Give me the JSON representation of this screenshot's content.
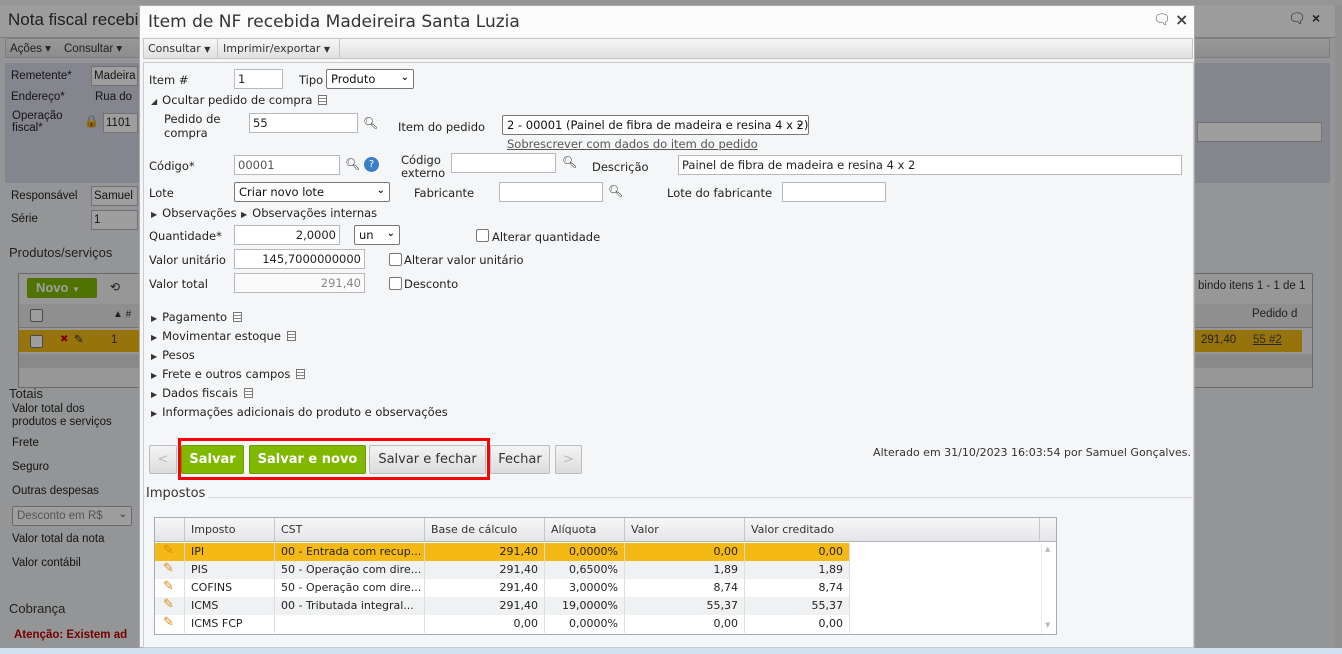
{
  "background": {
    "title": "Nota fiscal recebi",
    "menu": [
      "Ações",
      "Consultar"
    ],
    "remetente_label": "Remetente*",
    "remetente_value": "Madeira",
    "endereco_label": "Endereço*",
    "endereco_value": "Rua do",
    "operacao_label_1": "Operação",
    "operacao_label_2": "fiscal*",
    "operacao_value": "1101",
    "responsavel_label": "Responsável",
    "responsavel_value": "Samuel",
    "serie_label": "Série",
    "serie_value": "1",
    "produtos_title": "Produtos/serviços",
    "novo_label": "Novo",
    "grid_col_num": "#",
    "grid_row_num": "1",
    "paging": "bindo itens 1 - 1 de 1",
    "grid_col_pedido": "Pedido d",
    "grid_row_value": "291,40",
    "grid_row_pedido": "55 #2",
    "totais_title": "Totais",
    "totais": [
      "Valor total dos",
      "produtos e serviços",
      "Frete",
      "Seguro",
      "Outras despesas",
      "Valor total da nota",
      "Valor contábil"
    ],
    "desconto_select": "Desconto em R$",
    "cobranca_title": "Cobrança",
    "warning": "Atenção: Existem ad"
  },
  "modal": {
    "title": "Item de NF recebida Madeireira Santa Luzia",
    "toolbar": [
      "Consultar",
      "Imprimir/exportar"
    ],
    "item_label": "Item #",
    "item_value": "1",
    "tipo_label": "Tipo",
    "tipo_value": "Produto",
    "ocultar_pedido": "Ocultar pedido de compra",
    "pedido_label_1": "Pedido de",
    "pedido_label_2": "compra",
    "pedido_value": "55",
    "item_pedido_label": "Item do pedido",
    "item_pedido_value": "2 - 00001 (Painel de fibra de madeira e resina 4 x 2)",
    "sobrescrever_link": "Sobrescrever com dados do item do pedido",
    "codigo_label": "Código*",
    "codigo_value": "00001",
    "codigo_ext_label_1": "Código",
    "codigo_ext_label_2": "externo",
    "codigo_ext_value": "",
    "descricao_label": "Descrição",
    "descricao_value": "Painel de fibra de madeira e resina 4 x 2",
    "lote_label": "Lote",
    "lote_value": "Criar novo lote",
    "fabricante_label": "Fabricante",
    "fabricante_value": "",
    "lote_fab_label": "Lote do fabricante",
    "lote_fab_value": "",
    "observacoes": "Observações",
    "observacoes_internas": "Observações internas",
    "quantidade_label": "Quantidade*",
    "quantidade_value": "2,0000",
    "unidade_value": "un",
    "alterar_quantidade": "Alterar quantidade",
    "valor_unit_label": "Valor unitário",
    "valor_unit_value": "145,7000000000",
    "alterar_valor_unit": "Alterar valor unitário",
    "valor_total_label": "Valor total",
    "valor_total_value": "291,40",
    "desconto": "Desconto",
    "sections": [
      "Pagamento",
      "Movimentar estoque",
      "Pesos",
      "Frete e outros campos",
      "Dados fiscais",
      "Informações adicionais do produto e observações"
    ],
    "buttons": {
      "prev": "<",
      "salvar": "Salvar",
      "salvar_novo": "Salvar e novo",
      "salvar_fechar": "Salvar e fechar",
      "fechar": "Fechar",
      "next": ">"
    },
    "alterado": "Alterado em 31/10/2023 16:03:54 por Samuel Gonçalves.",
    "impostos_title": "Impostos",
    "impostos_columns": [
      "Imposto",
      "CST",
      "Base de cálculo",
      "Alíquota",
      "Valor",
      "Valor creditado"
    ],
    "impostos_rows": [
      [
        "IPI",
        "00 - Entrada com recup...",
        "291,40",
        "0,0000%",
        "0,00",
        "0,00"
      ],
      [
        "PIS",
        "50 - Operação com dire...",
        "291,40",
        "0,6500%",
        "1,89",
        "1,89"
      ],
      [
        "COFINS",
        "50 - Operação com dire...",
        "291,40",
        "3,0000%",
        "8,74",
        "8,74"
      ],
      [
        "ICMS",
        "00 - Tributada integral...",
        "291,40",
        "19,0000%",
        "55,37",
        "55,37"
      ],
      [
        "ICMS FCP",
        "",
        "0,00",
        "0,0000%",
        "0,00",
        "0,00"
      ]
    ]
  },
  "colors": {
    "accent_green": "#80b800",
    "selected_row": "#f4b914",
    "highlight_box": "#ff0000",
    "warning_text": "#c00000"
  }
}
